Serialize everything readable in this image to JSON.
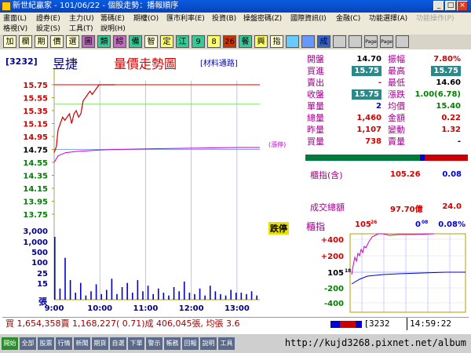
{
  "window": {
    "title": "新世紀贏家 - 101/06/22 - 個股走勢：播報順序",
    "btn_min": "_",
    "btn_max": "□",
    "btn_close": "×"
  },
  "menu": {
    "row1": [
      {
        "label": "畫面(L)",
        "dim": false
      },
      {
        "label": "證券(E)",
        "dim": false
      },
      {
        "label": "主力(U)",
        "dim": false
      },
      {
        "label": "籌碼(E)",
        "dim": false
      },
      {
        "label": "期權(O)",
        "dim": false
      },
      {
        "label": "匯市利率(E)",
        "dim": false
      },
      {
        "label": "投資(B)",
        "dim": false
      },
      {
        "label": "操盤密碼(Z)",
        "dim": false
      },
      {
        "label": "國際資訊(I)",
        "dim": false
      },
      {
        "label": "金融(C)",
        "dim": false
      },
      {
        "label": "功能選擇(A)",
        "dim": false
      },
      {
        "label": "功能操作(P)",
        "dim": true
      }
    ],
    "row2": [
      {
        "label": "格視(V)",
        "dim": false
      },
      {
        "label": "設定(S)",
        "dim": false
      },
      {
        "label": "工具(T)",
        "dim": false
      },
      {
        "label": "說明(H)",
        "dim": false
      }
    ]
  },
  "toolbar": [
    {
      "label": "加",
      "bg": "#ffffcc"
    },
    {
      "label": "欄",
      "bg": "#ffffcc"
    },
    {
      "label": "期",
      "bg": "#ffffcc"
    },
    {
      "label": "價",
      "bg": "#ffffcc"
    },
    {
      "label": "選",
      "bg": "#ffffcc"
    },
    {
      "label": "圖",
      "bg": "#cc66cc"
    },
    {
      "label": "類",
      "bg": "#33cc99"
    },
    {
      "label": "綜",
      "bg": "#cc66cc"
    },
    {
      "label": "備",
      "bg": "#33cc99"
    },
    {
      "label": "智",
      "bg": "#ffffcc"
    },
    {
      "label": "定",
      "bg": "#ffff66"
    },
    {
      "label": "江",
      "bg": "#33cc99"
    },
    {
      "label": "9",
      "bg": "#33cc99"
    },
    {
      "label": "8",
      "bg": "#ffff66"
    },
    {
      "label": "26",
      "bg": "#cc3300"
    },
    {
      "label": "餐",
      "bg": "#33cc99"
    },
    {
      "label": "興",
      "bg": "#ffff66"
    },
    {
      "label": "指",
      "bg": "#ffffcc"
    },
    {
      "label": "",
      "bg": "#66ccff"
    },
    {
      "label": "",
      "bg": "#6699ff"
    },
    {
      "label": "成",
      "bg": "#3366cc"
    },
    {
      "label": "",
      "bg": "#cccccc"
    },
    {
      "label": "",
      "bg": "#cccccc"
    },
    {
      "label": "Page",
      "bg": "#cccccc"
    },
    {
      "label": "Page",
      "bg": "#cccccc"
    },
    {
      "label": "",
      "bg": "#cccccc"
    }
  ],
  "chart": {
    "code": "[3232]",
    "name": "昱捷",
    "title": "量價走勢圖",
    "material": "[材料通路]",
    "limit_tag": "(漲停)",
    "limit_down_tag": "跌停",
    "vol_unit": "張",
    "colors": {
      "up": "#d00000",
      "down": "#008000",
      "flat": "#000000",
      "vol": "#0000cc",
      "avg": "#cc00cc"
    }
  },
  "chart_data": {
    "type": "line",
    "price_ticks": [
      "15.75",
      "15.55",
      "15.35",
      "15.15",
      "14.95",
      "14.75",
      "14.55",
      "14.35",
      "14.15",
      "13.95",
      "13.75"
    ],
    "price_range": [
      13.75,
      15.75
    ],
    "ref_price": 14.75,
    "vol_ticks": [
      "3,000",
      "1,000",
      "500",
      "100",
      "25",
      "15"
    ],
    "x_ticks": [
      "9:00",
      "10:00",
      "11:00",
      "12:00",
      "13:00"
    ],
    "price_series": [
      [
        0,
        14.7
      ],
      [
        3,
        14.8
      ],
      [
        5,
        15.05
      ],
      [
        8,
        15.15
      ],
      [
        11,
        15.25
      ],
      [
        14,
        15.2
      ],
      [
        17,
        15.25
      ],
      [
        20,
        15.3
      ],
      [
        23,
        15.15
      ],
      [
        26,
        15.3
      ],
      [
        29,
        15.35
      ],
      [
        32,
        15.25
      ],
      [
        35,
        15.3
      ],
      [
        38,
        15.5
      ],
      [
        41,
        15.55
      ],
      [
        44,
        15.6
      ],
      [
        47,
        15.65
      ],
      [
        50,
        15.6
      ],
      [
        53,
        15.65
      ],
      [
        56,
        15.7
      ],
      [
        59,
        15.75
      ],
      [
        63,
        15.75
      ],
      [
        70,
        15.75
      ],
      [
        80,
        15.75
      ]
    ],
    "avg_series": [
      [
        0,
        14.55
      ],
      [
        5,
        14.65
      ],
      [
        15,
        14.7
      ],
      [
        30,
        14.72
      ],
      [
        60,
        14.74
      ],
      [
        80,
        14.75
      ],
      [
        120,
        14.76
      ],
      [
        180,
        14.77
      ],
      [
        240,
        14.78
      ],
      [
        270,
        14.78
      ]
    ],
    "volumes": [
      [
        0,
        45
      ],
      [
        2,
        8
      ],
      [
        4,
        30
      ],
      [
        6,
        14
      ],
      [
        8,
        5
      ],
      [
        10,
        12
      ],
      [
        12,
        3
      ],
      [
        14,
        6
      ],
      [
        16,
        11
      ],
      [
        18,
        4
      ],
      [
        20,
        7
      ],
      [
        22,
        15
      ],
      [
        24,
        4
      ],
      [
        26,
        9
      ],
      [
        28,
        12
      ],
      [
        30,
        5
      ],
      [
        32,
        14
      ],
      [
        34,
        6
      ],
      [
        36,
        10
      ],
      [
        38,
        4
      ],
      [
        40,
        8
      ],
      [
        42,
        5
      ],
      [
        44,
        3
      ],
      [
        46,
        9
      ],
      [
        48,
        6
      ],
      [
        50,
        13
      ],
      [
        52,
        5
      ],
      [
        54,
        4
      ],
      [
        56,
        8
      ],
      [
        58,
        3
      ],
      [
        60,
        10
      ],
      [
        62,
        6
      ],
      [
        64,
        4
      ],
      [
        66,
        3
      ],
      [
        68,
        7
      ],
      [
        70,
        5
      ],
      [
        72,
        5
      ],
      [
        74,
        4
      ],
      [
        76,
        6
      ],
      [
        78,
        3
      ]
    ],
    "minutes_total": 270
  },
  "quote": {
    "open_label": "開盤",
    "open": "14.70",
    "amp_label": "振幅",
    "amp": "7.80%",
    "bid_label": "買進",
    "bid": "15.75",
    "high_label": "最高",
    "high": "15.75",
    "ask_label": "賣出",
    "ask": "-",
    "low_label": "最低",
    "low": "14.60",
    "close_label": "收盤",
    "close": "15.75",
    "change_label": "漲跌",
    "change": "1.00(6.78)",
    "unit_vol_label": "單量",
    "unit_vol": "2",
    "avg_label": "均價",
    "avg": "15.40",
    "total_vol_label": "總量",
    "total_vol": "1,460",
    "amount_label": "金額",
    "amount": "0.22",
    "prev_vol_label": "昨量",
    "prev_vol": "1,107",
    "change_vol_label": "變動",
    "change_vol": "1.32",
    "buy_vol_label": "買量",
    "buy_vol": "738",
    "sell_vol_label": "賣量",
    "sell_vol": "-"
  },
  "index": {
    "label": "櫃指(含)",
    "value": "105.26",
    "change": "0.08",
    "turnover_label": "成交總額",
    "turnover": "97.70億",
    "turnover_change": "24.0"
  },
  "mini": {
    "label": "櫃指",
    "value": "105",
    "value_small": "26",
    "change": "0",
    "change_small": "08",
    "pct": "0.08%",
    "ticks": [
      "+400",
      "+200",
      "105",
      "-200",
      "-400"
    ],
    "ticks_small": [
      "",
      "",
      "18",
      "",
      ""
    ]
  },
  "status": {
    "text": "買 1,654,358賣 1,168,227( 0.71)成 406,045張, 均張 3.6",
    "code": "3232",
    "time": "14:59:22"
  },
  "taskbar": [
    "開始",
    "全部",
    "股票",
    "行情",
    "新聞",
    "期貨",
    "自選",
    "下單",
    "警示",
    "帳務",
    "回報",
    "說明",
    "工具"
  ],
  "watermark": "http://kujd3268.pixnet.net/album"
}
